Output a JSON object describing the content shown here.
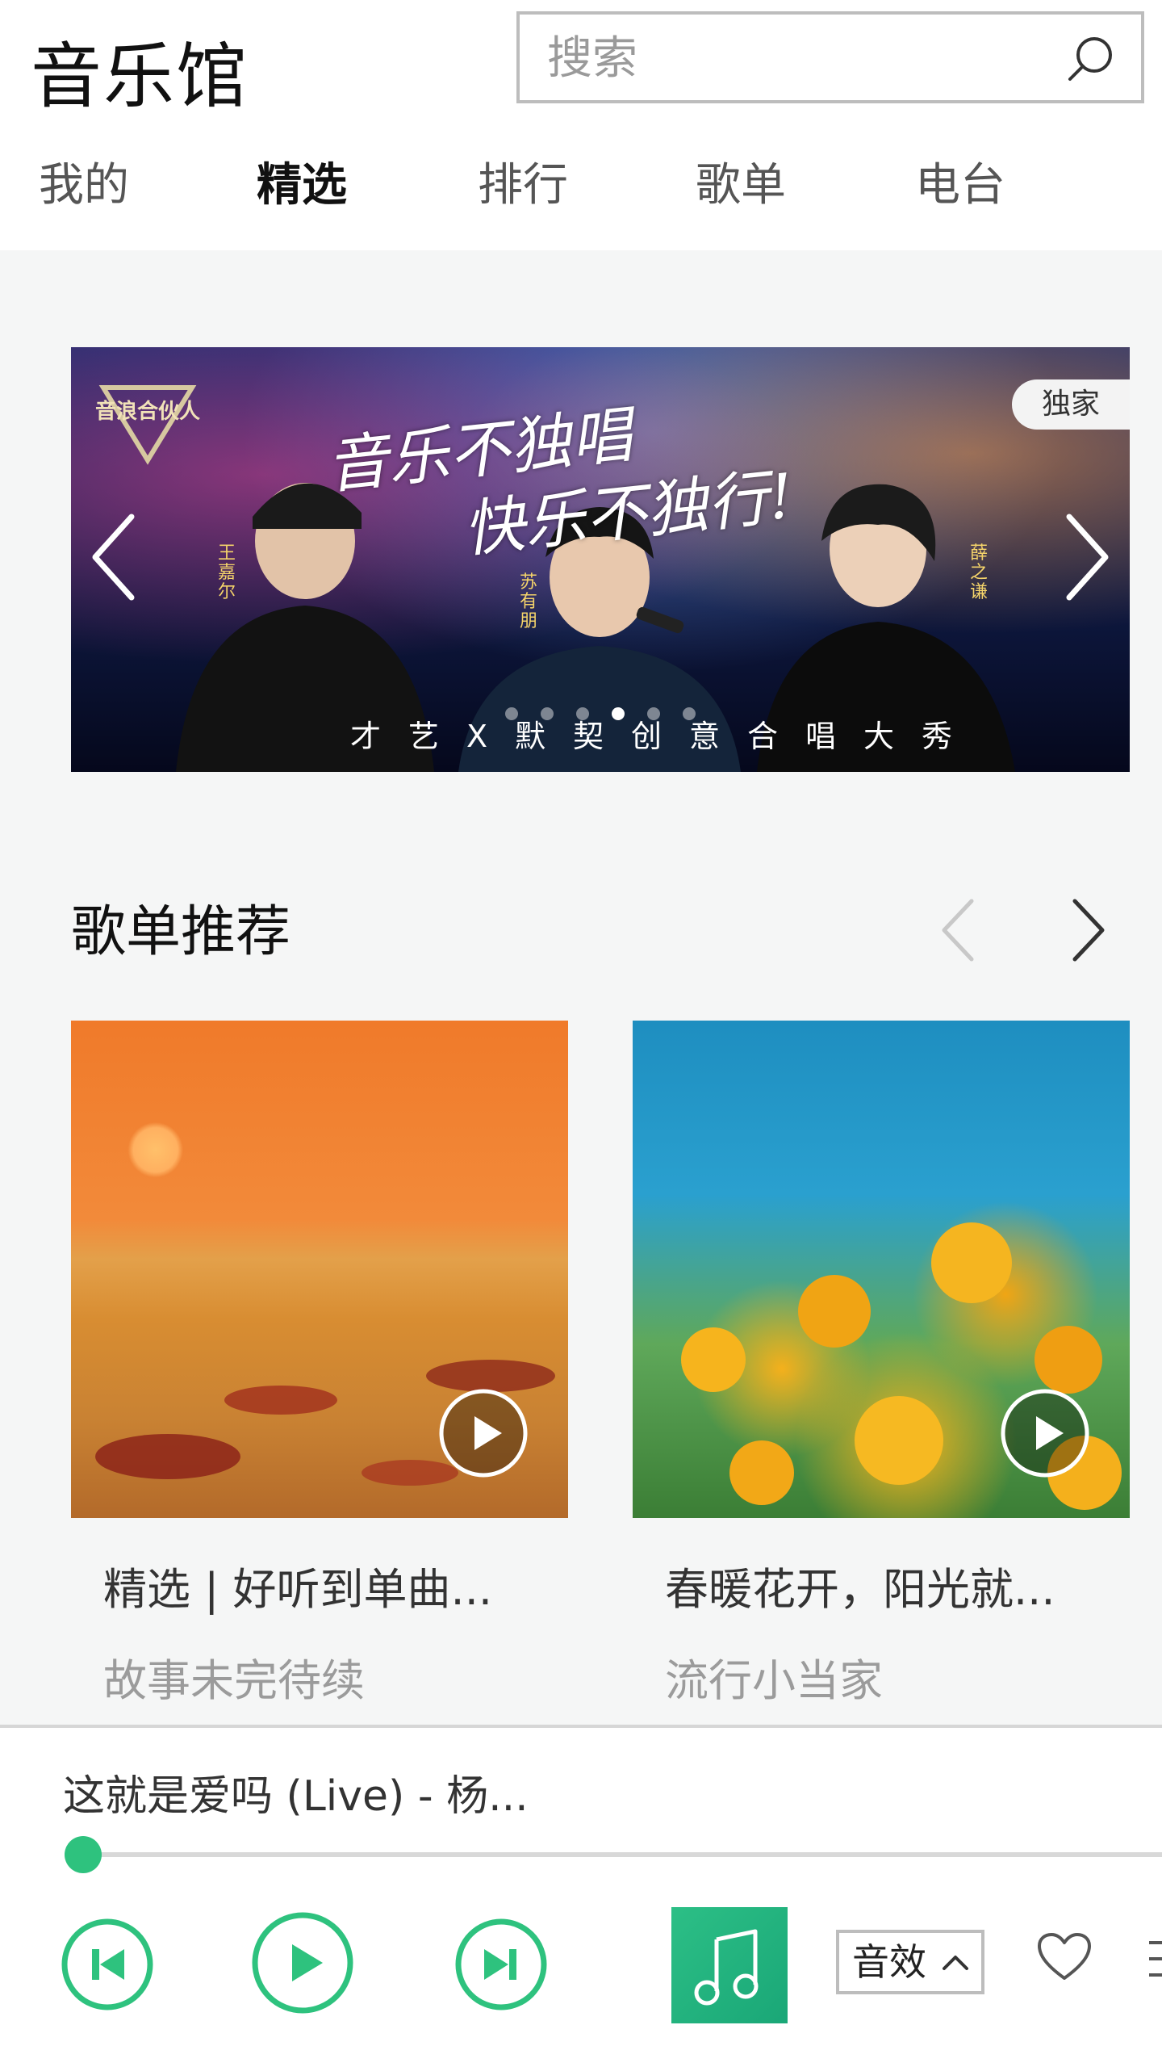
{
  "header": {
    "title": "音乐馆",
    "search_placeholder": "搜索"
  },
  "tabs": [
    {
      "label": "我的",
      "active": false
    },
    {
      "label": "精选",
      "active": true
    },
    {
      "label": "排行",
      "active": false
    },
    {
      "label": "歌单",
      "active": false
    },
    {
      "label": "电台",
      "active": false
    }
  ],
  "banner": {
    "logo_text": "音浪合伙人",
    "slogan_line1": "音乐不独唱",
    "slogan_line2": "快乐不独行!",
    "tagline": "才艺X默契创意合唱大秀",
    "badge": "独家",
    "singer_names": [
      "王嘉尔",
      "苏有朋",
      "薛之谦"
    ],
    "dot_count": 6,
    "active_dot": 3
  },
  "recommend": {
    "title": "歌单推荐",
    "cards": [
      {
        "title": "精选 | 好听到单曲...",
        "subtitle": "故事未完待续"
      },
      {
        "title": "春暖花开，阳光就...",
        "subtitle": "流行小当家"
      }
    ]
  },
  "player": {
    "now_playing": "这就是爱吗 (Live) - 杨...",
    "progress_fraction": 0.0,
    "effect_label": "音效"
  },
  "colors": {
    "accent": "#2ec27e",
    "content_bg": "#f5f6f6"
  }
}
